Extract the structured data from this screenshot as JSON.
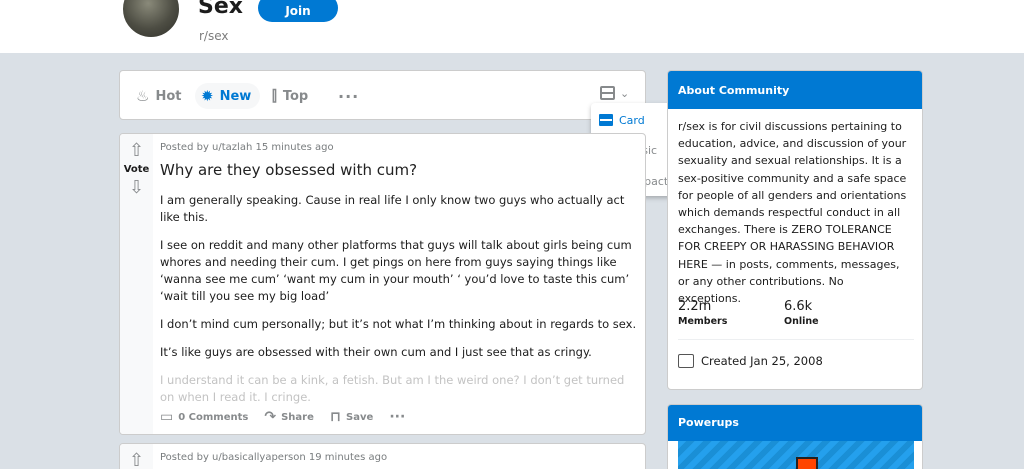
{
  "header": {
    "title": "Sex",
    "subreddit": "r/sex",
    "join_label": "Join"
  },
  "sort": {
    "hot": "Hot",
    "new": "New",
    "top": "Top",
    "more": "···"
  },
  "layout_menu": {
    "card": "Card",
    "classic": "Classic",
    "compact": "Compact"
  },
  "post1": {
    "meta": "Posted by u/tazlah 15 minutes ago",
    "title": "Why are they obsessed with cum?",
    "vote_label": "Vote",
    "body": [
      "I am generally speaking. Cause in real life I only know two guys who actually act like this.",
      "I see on reddit and many other platforms that guys will talk about girls being cum whores and needing their cum. I get pings on here from guys saying things like ‘wanna see me cum’ ‘want my cum in your mouth’ ‘ you’d love to taste this cum’ ‘wait till you see my big load’",
      "I don’t mind cum personally; but it’s not what I’m thinking about in regards to sex.",
      "It’s like guys are obsessed with their own cum and I just see that as cringy.",
      "I understand it can be a kink, a fetish. But am I the weird one? I don’t get turned on when I read it. I cringe."
    ],
    "comments": "0 Comments",
    "share": "Share",
    "save": "Save",
    "more": "···"
  },
  "post2": {
    "meta": "Posted by u/basicallyaperson 19 minutes ago"
  },
  "about": {
    "heading": "About Community",
    "description": "r/sex is for civil discussions pertaining to education, advice, and discussion of your sexuality and sexual relationships. It is a sex-positive community and a safe space for people of all genders and orientations which demands respectful conduct in all exchanges. There is ZERO TOLERANCE FOR CREEPY OR HARASSING BEHAVIOR HERE — in posts, comments, messages, or any other contributions. No exceptions.",
    "members_count": "2.2m",
    "members_label": "Members",
    "online_count": "6.6k",
    "online_label": "Online",
    "created": "Created Jan 25, 2008"
  },
  "powerups": {
    "heading": "Powerups"
  },
  "colors": {
    "accent": "#0079d3",
    "background": "#dae0e6"
  }
}
